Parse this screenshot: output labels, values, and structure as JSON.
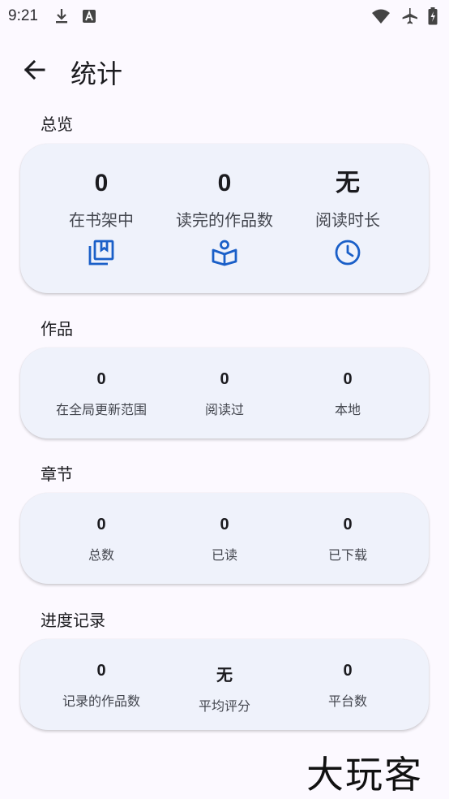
{
  "status_bar": {
    "time": "9:21"
  },
  "app_bar": {
    "title": "统计"
  },
  "overview": {
    "title": "总览",
    "items": [
      {
        "value": "0",
        "label": "在书架中",
        "icon": "library-icon"
      },
      {
        "value": "0",
        "label": "读完的作品数",
        "icon": "book-read-icon"
      },
      {
        "value": "无",
        "label": "阅读时长",
        "icon": "clock-icon"
      }
    ]
  },
  "works": {
    "title": "作品",
    "items": [
      {
        "value": "0",
        "label": "在全局更新范围"
      },
      {
        "value": "0",
        "label": "阅读过"
      },
      {
        "value": "0",
        "label": "本地"
      }
    ]
  },
  "chapters": {
    "title": "章节",
    "items": [
      {
        "value": "0",
        "label": "总数"
      },
      {
        "value": "0",
        "label": "已读"
      },
      {
        "value": "0",
        "label": "已下载"
      }
    ]
  },
  "tracking": {
    "title": "进度记录",
    "items": [
      {
        "value": "0",
        "label": "记录的作品数"
      },
      {
        "value": "无",
        "label": "平均评分"
      },
      {
        "value": "0",
        "label": "平台数"
      }
    ]
  },
  "watermark": "大玩客",
  "colors": {
    "accent": "#1a5fc8",
    "card": "#eff2fb",
    "background": "#fcf9ff"
  }
}
